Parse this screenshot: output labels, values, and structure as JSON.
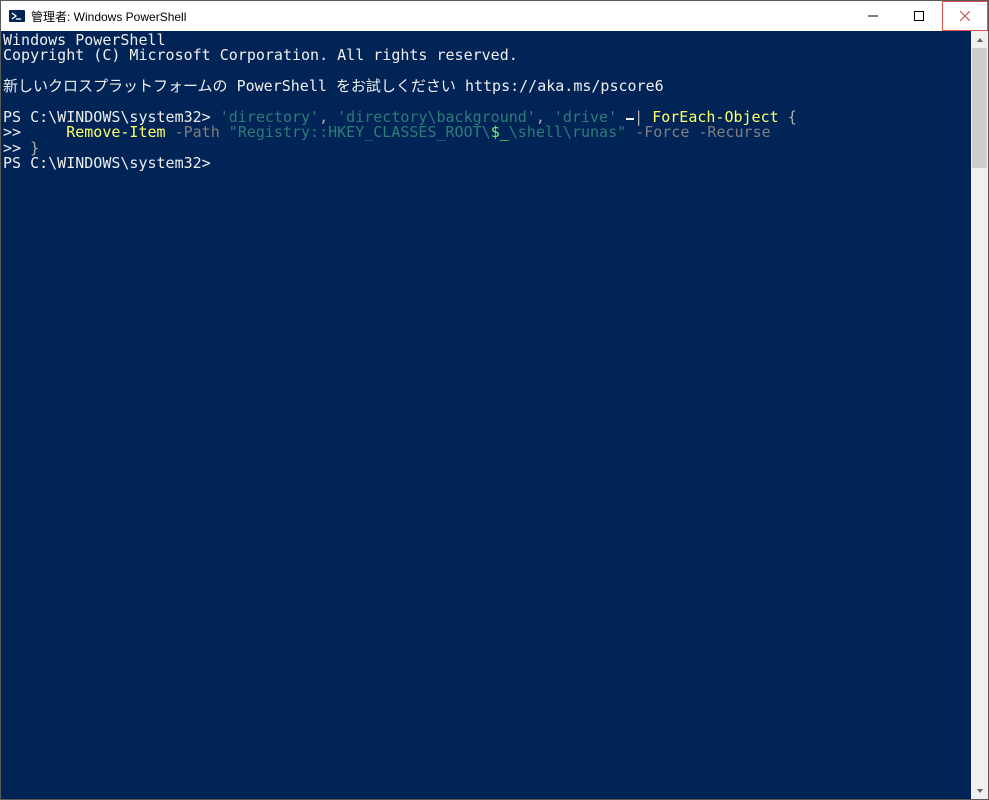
{
  "titlebar": {
    "title": "管理者: Windows PowerShell"
  },
  "terminal": {
    "banner1": "Windows PowerShell",
    "banner2": "Copyright (C) Microsoft Corporation. All rights reserved.",
    "pscore": "新しいクロスプラットフォームの PowerShell をお試しください https://aka.ms/pscore6",
    "prompt": "PS C:\\WINDOWS\\system32>",
    "continuation": ">>",
    "cmd": {
      "arg_directory": "'directory'",
      "sep1": ", ",
      "arg_background": "'directory\\background'",
      "sep2": ", ",
      "arg_drive": "'drive'",
      "space1": " ",
      "pipe": "|",
      "space2": " ",
      "foreach": "ForEach-Object",
      "space3": " ",
      "brace_open": "{",
      "indent": "     ",
      "remove_item": "Remove-Item",
      "sp_a": " ",
      "p_path": "-Path",
      "sp_b": " ",
      "reg_q1": "\"",
      "reg_prefix": "Registry::HKEY_CLASSES_ROOT\\",
      "reg_var": "$_",
      "reg_suffix": "\\shell\\runas",
      "reg_q2": "\"",
      "sp_c": " ",
      "p_force": "-Force",
      "sp_d": " ",
      "p_recurse": "-Recurse",
      "brace_close": "}"
    }
  }
}
